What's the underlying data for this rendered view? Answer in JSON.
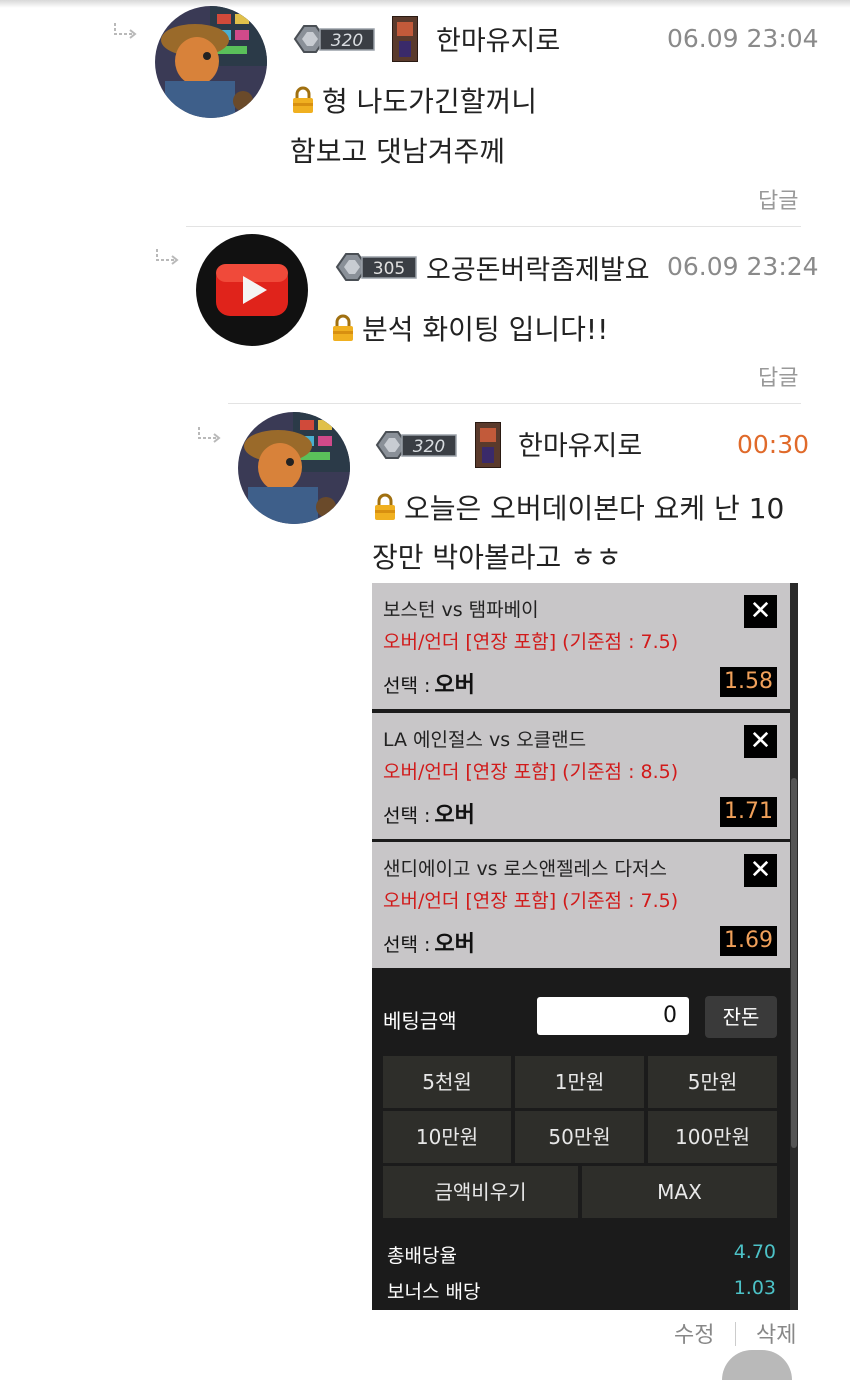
{
  "comments": [
    {
      "nickname": "한마유지로",
      "level": "320",
      "time": "06.09 23:04",
      "lines": [
        "형 나도가긴할꺼니",
        "함보고 댓남겨주께"
      ],
      "reply_label": "답글"
    },
    {
      "nickname": "오공돈버락좀제발요",
      "level": "305",
      "time": "06.09 23:24",
      "lines": [
        "분석 화이팅 입니다!!"
      ],
      "reply_label": "답글"
    },
    {
      "nickname": "한마유지로",
      "level": "320",
      "time": "00:30",
      "lines": [
        "오늘은 오버데이본다 요케 난 10",
        "장만 박아볼라고 ㅎㅎ"
      ]
    }
  ],
  "bet_slip": {
    "items": [
      {
        "match": "보스턴 vs 탬파베이",
        "market": "오버/언더 [연장 포함] (기준점 : 7.5)",
        "choice_label": "선택 :",
        "choice": "오버",
        "odds": "1.58"
      },
      {
        "match": "LA 에인절스 vs 오클랜드",
        "market": "오버/언더 [연장 포함] (기준점 : 8.5)",
        "choice_label": "선택 :",
        "choice": "오버",
        "odds": "1.71"
      },
      {
        "match": "샌디에이고 vs 로스앤젤레스 다저스",
        "market": "오버/언더 [연장 포함] (기준점 : 7.5)",
        "choice_label": "선택 :",
        "choice": "오버",
        "odds": "1.69"
      }
    ],
    "close_symbol": "✕",
    "bet_amount_label": "베팅금액",
    "bet_amount_value": "0",
    "balance_button": "잔돈",
    "amount_buttons": [
      "5천원",
      "1만원",
      "5만원",
      "10만원",
      "50만원",
      "100만원"
    ],
    "clear_button": "금액비우기",
    "max_button": "MAX",
    "total_odds_label": "총배당율",
    "total_odds_value": "4.70",
    "bonus_label": "보너스 배당",
    "bonus_value": "1.03"
  },
  "footer": {
    "edit": "수정",
    "delete": "삭제"
  },
  "colors": {
    "time_new": "#e06a2a",
    "market_red": "#d11a1a",
    "odds_orange": "#f0a05a",
    "summary_teal": "#4cc2c7"
  }
}
